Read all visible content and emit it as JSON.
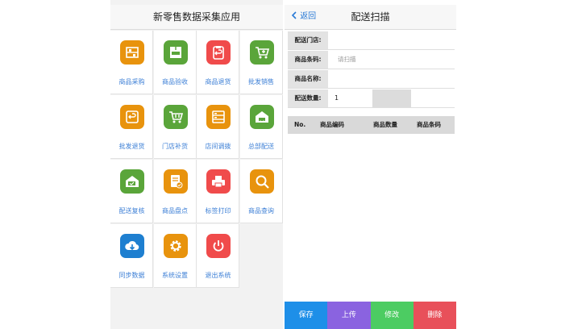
{
  "left": {
    "title": "新零售数据采集应用",
    "items": [
      {
        "label": "商品采购",
        "icon": "shelf-icon",
        "color": "#e8930d"
      },
      {
        "label": "商品验收",
        "icon": "inspection-icon",
        "color": "#5aa53a"
      },
      {
        "label": "商品退货",
        "icon": "return-clipboard-icon",
        "color": "#f04b4b"
      },
      {
        "label": "批发销售",
        "icon": "cart-plus-icon",
        "color": "#5aa53a"
      },
      {
        "label": "批发退货",
        "icon": "return-box-icon",
        "color": "#e8930d"
      },
      {
        "label": "门店补货",
        "icon": "cart-icon",
        "color": "#5aa53a"
      },
      {
        "label": "店间调拨",
        "icon": "cabinet-icon",
        "color": "#e8930d"
      },
      {
        "label": "总部配送",
        "icon": "warehouse-truck-icon",
        "color": "#5aa53a"
      },
      {
        "label": "配送复核",
        "icon": "truck-check-icon",
        "color": "#5aa53a"
      },
      {
        "label": "商品盘点",
        "icon": "document-check-icon",
        "color": "#e8930d"
      },
      {
        "label": "标签打印",
        "icon": "printer-icon",
        "color": "#f04b4b"
      },
      {
        "label": "商品查询",
        "icon": "magnifier-icon",
        "color": "#e8930d"
      },
      {
        "label": "同步数据",
        "icon": "cloud-download-icon",
        "color": "#1e7fd0"
      },
      {
        "label": "系统设置",
        "icon": "gear-icon",
        "color": "#e8930d"
      },
      {
        "label": "退出系统",
        "icon": "power-icon",
        "color": "#f04b4b"
      }
    ]
  },
  "right": {
    "back_label": "返回",
    "title": "配送扫描",
    "fields": {
      "store_label": "配送门店:",
      "barcode_label": "商品条码:",
      "barcode_placeholder": "请扫描",
      "name_label": "商品名称:",
      "qty_label": "配送数量:",
      "qty_value": "1"
    },
    "table_headers": [
      "No.",
      "商品编码",
      "商品数量",
      "商品条码"
    ],
    "buttons": [
      {
        "label": "保存",
        "color": "#1e8fe8"
      },
      {
        "label": "上传",
        "color": "#8a63e0"
      },
      {
        "label": "修改",
        "color": "#4ccc62"
      },
      {
        "label": "删除",
        "color": "#e8505a"
      }
    ]
  }
}
